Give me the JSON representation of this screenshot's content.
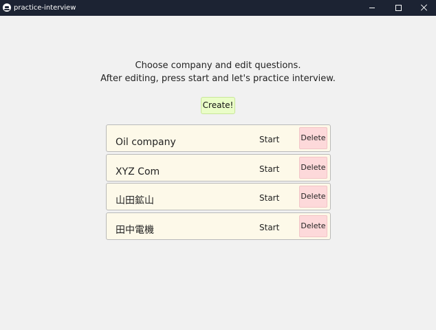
{
  "window": {
    "title": "practice-interview"
  },
  "instructions": {
    "line1": "Choose company and edit questions.",
    "line2": "After editing, press start and let's practice interview."
  },
  "create_label": "Create!",
  "companies": [
    {
      "name": "Oil company",
      "start_label": "Start",
      "delete_label": "Delete"
    },
    {
      "name": "XYZ Com",
      "start_label": "Start",
      "delete_label": "Delete"
    },
    {
      "name": "山田鉱山",
      "start_label": "Start",
      "delete_label": "Delete"
    },
    {
      "name": "田中電機",
      "start_label": "Start",
      "delete_label": "Delete"
    }
  ],
  "colors": {
    "titlebar": "#1c2333",
    "background": "#f1f1f1",
    "row_background": "#fdf9e9",
    "create_button": "#eafdc8",
    "delete_button": "#fdd9da"
  },
  "icons": {
    "app": "app-logo-icon",
    "minimize": "minimize-icon",
    "maximize": "maximize-icon",
    "close": "close-icon"
  }
}
